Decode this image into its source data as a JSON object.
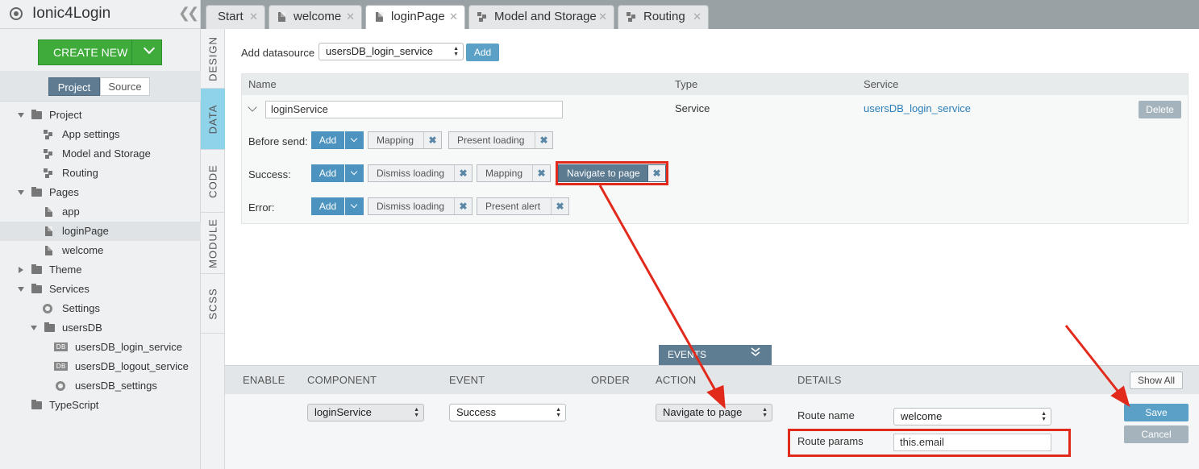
{
  "app": {
    "title": "Ionic4Login"
  },
  "sidebar": {
    "create_label": "CREATE NEW",
    "tabs": [
      "Project",
      "Source"
    ],
    "tree": [
      {
        "label": "Project",
        "icon": "folder-icon"
      },
      {
        "label": "App settings",
        "icon": "model-icon"
      },
      {
        "label": "Model and Storage",
        "icon": "model-icon"
      },
      {
        "label": "Routing",
        "icon": "model-icon"
      },
      {
        "label": "Pages",
        "icon": "folder-icon"
      },
      {
        "label": "app",
        "icon": "file-icon"
      },
      {
        "label": "loginPage",
        "icon": "file-icon",
        "selected": true
      },
      {
        "label": "welcome",
        "icon": "file-icon"
      },
      {
        "label": "Theme",
        "icon": "folder-icon"
      },
      {
        "label": "Services",
        "icon": "folder-icon"
      },
      {
        "label": "Settings",
        "icon": "gear-icon"
      },
      {
        "label": "usersDB",
        "icon": "folder-icon"
      },
      {
        "label": "usersDB_login_service",
        "icon": "db-icon"
      },
      {
        "label": "usersDB_logout_service",
        "icon": "db-icon"
      },
      {
        "label": "usersDB_settings",
        "icon": "gear-icon"
      },
      {
        "label": "TypeScript",
        "icon": "folder-icon"
      }
    ],
    "db_badge": "DB"
  },
  "tabs": [
    {
      "label": "Start"
    },
    {
      "label": "welcome"
    },
    {
      "label": "loginPage",
      "active": true
    },
    {
      "label": "Model and Storage"
    },
    {
      "label": "Routing"
    }
  ],
  "vertical_tabs": [
    "DESIGN",
    "DATA",
    "CODE",
    "MODULE",
    "SCSS"
  ],
  "data_panel": {
    "add_datasource_label": "Add datasource",
    "datasource_selected": "usersDB_login_service",
    "add_label": "Add",
    "columns": [
      "Name",
      "Type",
      "Service"
    ],
    "row": {
      "name": "loginService",
      "type": "Service",
      "service": "usersDB_login_service",
      "delete_label": "Delete"
    },
    "before_send": {
      "label": "Before send:",
      "add": "Add",
      "chips": [
        "Mapping",
        "Present loading"
      ]
    },
    "success": {
      "label": "Success:",
      "add": "Add",
      "chips": [
        "Dismiss loading",
        "Mapping",
        "Navigate to page"
      ]
    },
    "error": {
      "label": "Error:",
      "add": "Add",
      "chips": [
        "Dismiss loading",
        "Present alert"
      ]
    },
    "chip_remove": "✖"
  },
  "events": {
    "tab_label": "EVENTS",
    "columns": [
      "ENABLE",
      "COMPONENT",
      "EVENT",
      "ORDER",
      "ACTION",
      "DETAILS"
    ],
    "show_all": "Show All",
    "component": "loginService",
    "event": "Success",
    "action": "Navigate to page",
    "route_name_label": "Route name",
    "route_name": "welcome",
    "route_params_label": "Route params",
    "route_params": "this.email",
    "save": "Save",
    "cancel": "Cancel"
  },
  "colors": {
    "annotation": "#e22a1c",
    "accent": "#5aa0c7",
    "create": "#3eab3b",
    "active_vtab": "#8fd3ea"
  }
}
